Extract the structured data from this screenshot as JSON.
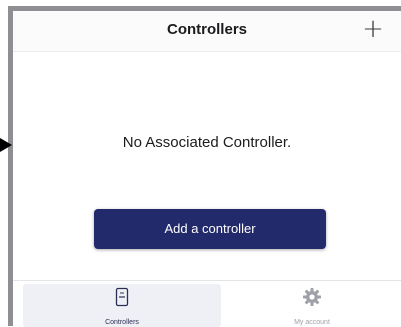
{
  "header": {
    "title": "Controllers",
    "add_label": "+"
  },
  "main": {
    "empty_message": "No Associated Controller.",
    "add_button_label": "Add a controller"
  },
  "tabbar": {
    "tabs": [
      {
        "label": "Controllers",
        "icon": "controller-icon",
        "selected": true
      },
      {
        "label": "My account",
        "icon": "gear-icon",
        "selected": false
      }
    ]
  },
  "colors": {
    "primary_button": "#232a6b",
    "active_tab_bg": "#eef0f6",
    "frame": "#8e8e93"
  }
}
